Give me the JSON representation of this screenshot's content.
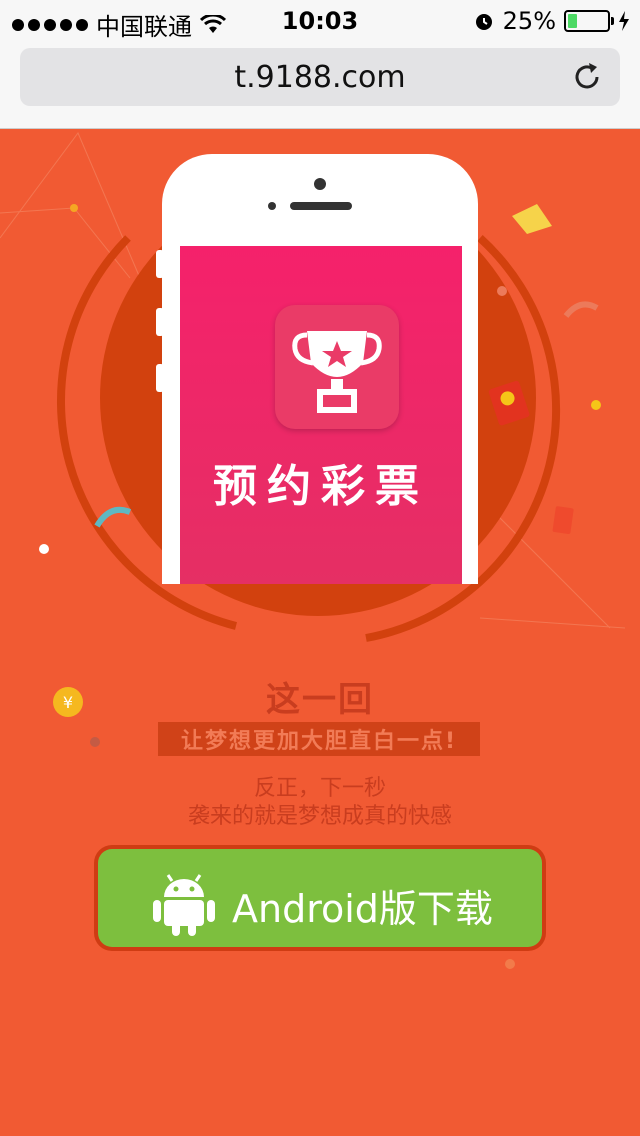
{
  "status_bar": {
    "carrier": "中国联通",
    "time": "10:03",
    "battery_percent": "25%",
    "battery_level": 0.25,
    "icons": [
      "signal-dots",
      "wifi-icon",
      "alarm-icon",
      "battery-icon",
      "charging-icon"
    ]
  },
  "browser": {
    "url": "t.9188.com",
    "reload_icon": "reload-icon"
  },
  "hero": {
    "app_name": "预约彩票",
    "app_icon": "trophy-icon"
  },
  "copy": {
    "headline": "这一回",
    "banner": "让梦想更加大胆直白一点!",
    "line1": "反正，下一秒",
    "line2": "袭来的就是梦想成真的快感"
  },
  "download": {
    "label": "Android版下载",
    "icon": "android-icon"
  },
  "colors": {
    "background": "#f15a33",
    "circle": "#d0400f",
    "screen": "#f5216b",
    "button": "#7dbf3e"
  }
}
